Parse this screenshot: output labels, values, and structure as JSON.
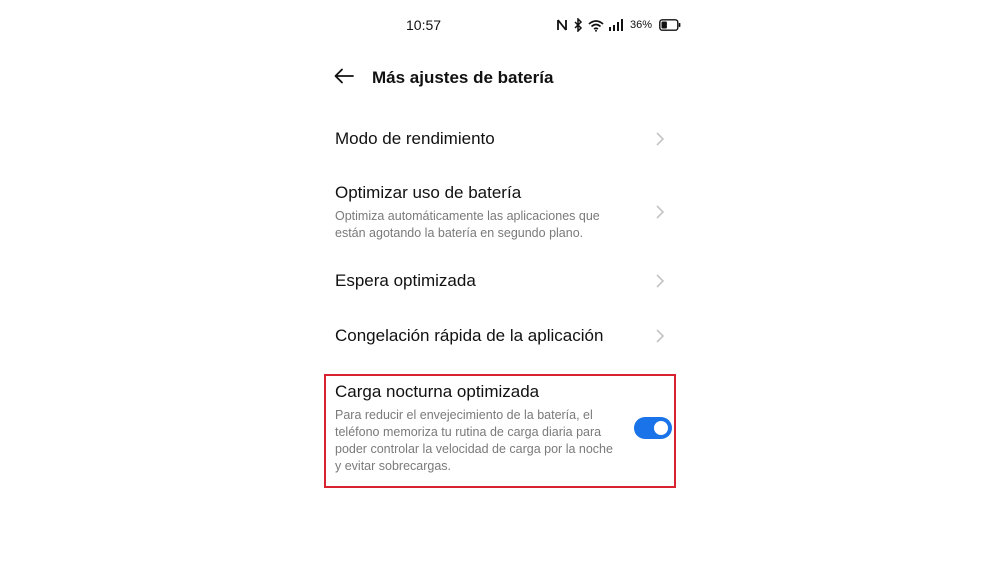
{
  "status_bar": {
    "time": "10:57",
    "battery_percent": "36%",
    "icons": [
      "nfc-icon",
      "bluetooth-icon",
      "wifi-icon",
      "signal-icon",
      "battery-icon"
    ],
    "battery_level": 0.36
  },
  "header": {
    "back_icon": "arrow-left-icon",
    "title": "Más ajustes de batería"
  },
  "settings": [
    {
      "title": "Modo de rendimiento",
      "description": "",
      "control": "chevron"
    },
    {
      "title": "Optimizar uso de batería",
      "description": "Optimiza automáticamente las aplicaciones que están agotando la batería en segundo plano.",
      "control": "chevron"
    },
    {
      "title": "Espera optimizada",
      "description": "",
      "control": "chevron"
    },
    {
      "title": "Congelación rápida de la aplicación",
      "description": "",
      "control": "chevron"
    },
    {
      "title": "Carga nocturna optimizada",
      "description": "Para reducir el envejecimiento de la batería, el teléfono memoriza tu rutina de carga diaria para poder controlar la velocidad de carga por la noche y evitar sobrecargas.",
      "control": "toggle",
      "toggle_on": true,
      "highlighted": true
    }
  ],
  "colors": {
    "accent": "#1a73e8",
    "highlight_border": "#d6232f",
    "secondary_text": "#7a7a7a",
    "chevron": "#c4c4c4"
  }
}
